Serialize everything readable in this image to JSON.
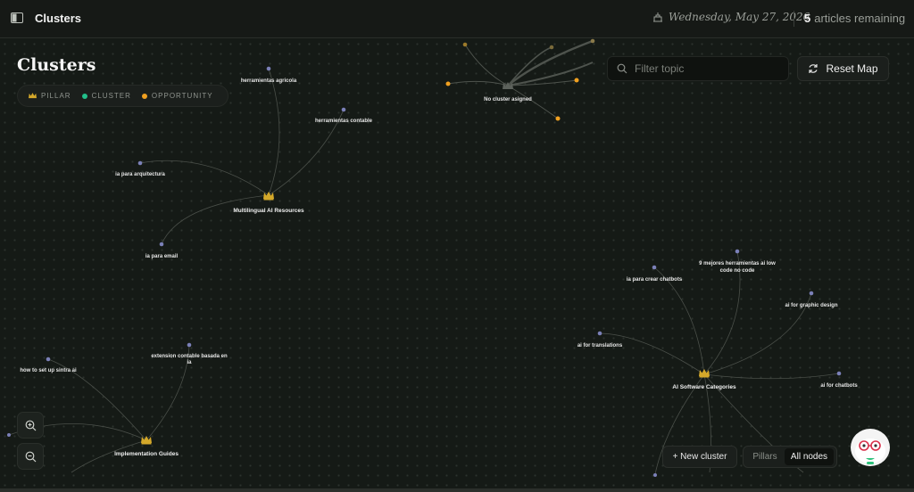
{
  "header": {
    "title": "Clusters",
    "date": "Wednesday, May 27, 2026",
    "remaining_count": "5",
    "remaining_label": "articles remaining"
  },
  "page": {
    "heading": "Clusters"
  },
  "legend": {
    "pillar": "PILLAR",
    "cluster": "CLUSTER",
    "opportunity": "OPPORTUNITY"
  },
  "colors": {
    "pillar": "#d4a82a",
    "cluster": "#22c08a",
    "opportunity": "#f0a020",
    "node": "#7b80b8",
    "background": "#151a16"
  },
  "search": {
    "placeholder": "Filter topic",
    "value": ""
  },
  "toolbar": {
    "reset_label": "Reset Map",
    "new_cluster_label": "+ New cluster",
    "view_options": [
      "Pillars",
      "All nodes"
    ],
    "view_selected": "All nodes"
  },
  "graph": {
    "pillars": [
      {
        "label": "Multilingual AI Resources",
        "children": [
          "herramientas agricola",
          "herramientas contable",
          "ia para arquitectura",
          "ia para email"
        ]
      },
      {
        "label": "Implementation Guides",
        "children": [
          "how to set up sintra ai",
          "extension contable basada en ia"
        ]
      },
      {
        "label": "AI Software Categories",
        "children": [
          "ia para crear chatbots",
          "9 mejores herramientas ai low code no code",
          "ai for graphic design",
          "ai for translations",
          "ai for chatbots"
        ]
      }
    ],
    "unassigned_label": "No cluster asigned"
  },
  "icons": {
    "header": "book-icon",
    "date": "calendar-icon",
    "search": "search-icon",
    "reset": "refresh-icon",
    "zoom_in": "zoom-in-icon",
    "zoom_out": "zoom-out-icon",
    "pillar": "crown-icon",
    "mascot": "mascot-avatar"
  }
}
